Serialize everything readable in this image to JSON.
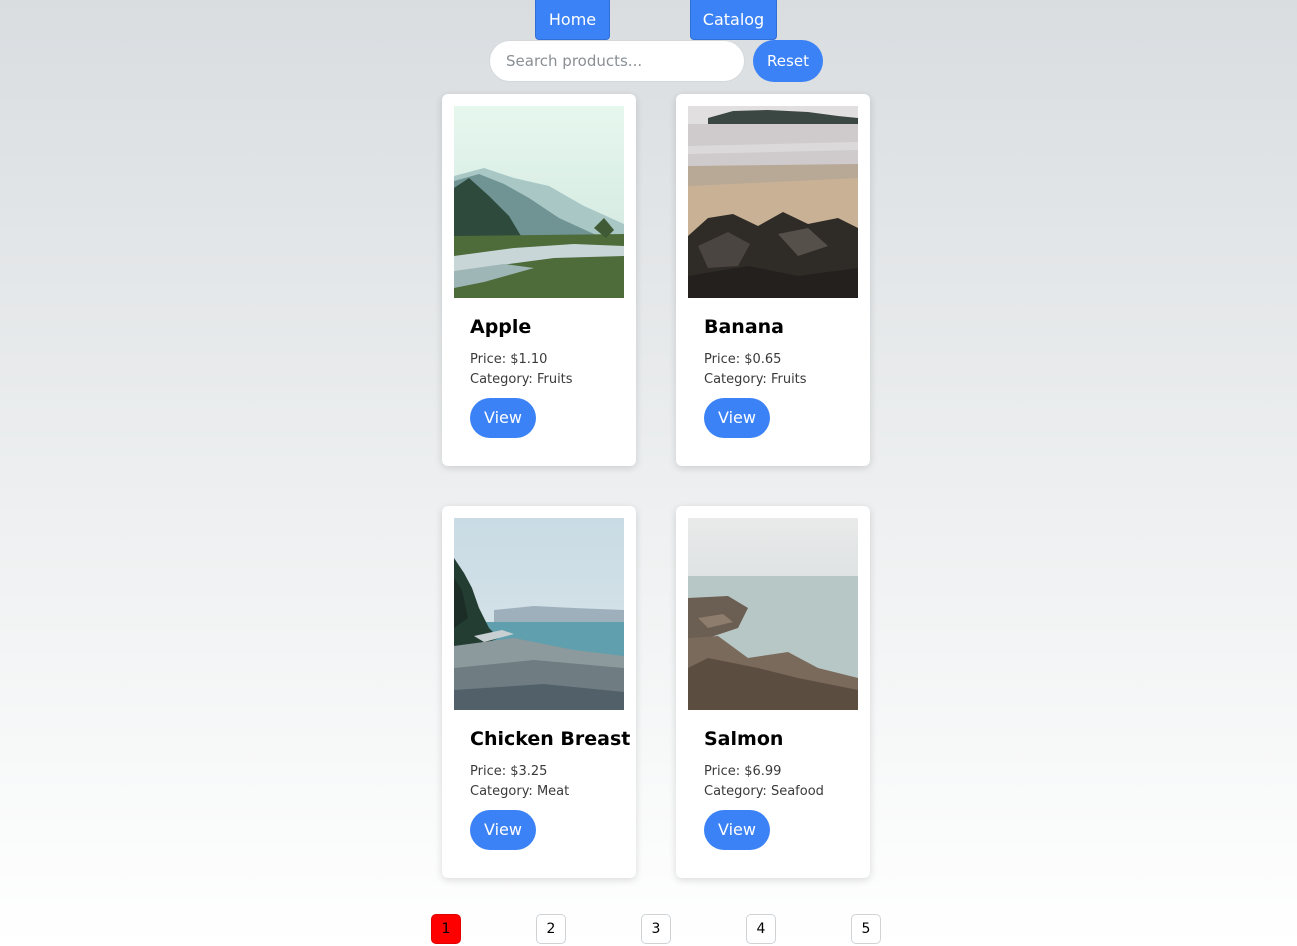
{
  "nav": {
    "home_label": "Home",
    "catalog_label": "Catalog"
  },
  "search": {
    "placeholder": "Search products...",
    "value": "",
    "reset_label": "Reset"
  },
  "products": [
    {
      "name": "Apple",
      "price": "Price: $1.10",
      "category": "Category: Fruits",
      "view_label": "View",
      "image": "misty-river-valley"
    },
    {
      "name": "Banana",
      "price": "Price: $0.65",
      "category": "Category: Fruits",
      "view_label": "View",
      "image": "beach-rocks"
    },
    {
      "name": "Chicken Breast",
      "price": "Price: $3.25",
      "category": "Category: Meat",
      "view_label": "View",
      "image": "pebble-shoreline"
    },
    {
      "name": "Salmon",
      "price": "Price: $6.99",
      "category": "Category: Seafood",
      "view_label": "View",
      "image": "coastal-rocks"
    }
  ],
  "pagination": {
    "pages": [
      "1",
      "2",
      "3",
      "4",
      "5"
    ],
    "current": "1"
  },
  "colors": {
    "accent": "#3b82f6",
    "active_page": "#ff0000",
    "card_bg": "#ffffff"
  }
}
